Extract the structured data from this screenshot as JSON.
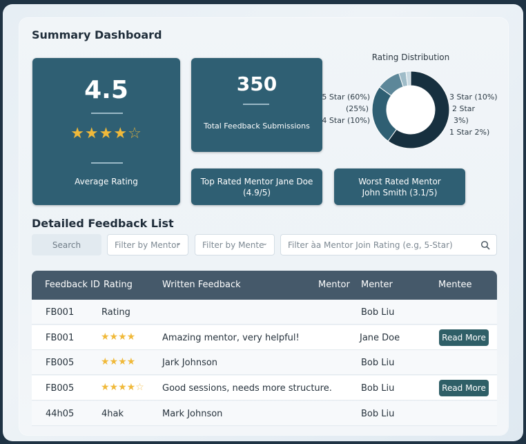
{
  "summary": {
    "title": "Summary Dashboard",
    "average": {
      "value": "4.5",
      "label": "Average Rating",
      "stars": 4.5
    },
    "total": {
      "value": "350",
      "label": "Total Feedback Submissions"
    },
    "top_mentor": {
      "line1": "Top Rated Mentor Jane Doe",
      "line2": "(4.9/5)"
    },
    "worst_mentor": {
      "line1": "Worst Rated Mentor",
      "line2": "John Smith (3.1/5)"
    },
    "distribution": {
      "title": "Rating Distribution",
      "left_labels": [
        "5 Star (60%)",
        "(25%)",
        "4 Star (10%)"
      ],
      "right_labels": [
        "3 Star (10%)",
        "2 Star",
        "3%)",
        "1 Star 2%)"
      ],
      "segments": [
        {
          "name": "5 Star",
          "percent": 60,
          "color": "#17303f"
        },
        {
          "name": "4 Star",
          "percent": 25,
          "color": "#2f5f73"
        },
        {
          "name": "3 Star",
          "percent": 10,
          "color": "#5d8799"
        },
        {
          "name": "2 Star",
          "percent": 3,
          "color": "#9fbcc8"
        },
        {
          "name": "1 Star",
          "percent": 2,
          "color": "#c9dae2"
        }
      ]
    }
  },
  "feedback": {
    "title": "Detailed Feedback List",
    "search_label": "Search",
    "filter_mentor": "Filter by Mentor",
    "filter_mentee": "Filter by Mente",
    "filter_text": "Filter àa Mentor Join Rating (e.g, 5-Star)",
    "columns": [
      "Feedback ID",
      "Rating",
      "Written Feedback",
      "Mentor",
      "Menter",
      "Mentee"
    ],
    "read_more_label": "Read More",
    "rows": [
      {
        "id": "FB001",
        "rating_text": "Rating",
        "stars": null,
        "feedback": "",
        "mentor": "Bob Liu",
        "read_more": false
      },
      {
        "id": "FB001",
        "rating_text": "",
        "stars": 4,
        "feedback": "Amazing mentor, very helpful!",
        "mentor": "Jane Doe",
        "read_more": true
      },
      {
        "id": "FB005",
        "rating_text": "",
        "stars": 4,
        "feedback": "Jark Johnson",
        "mentor": "Bob Liu",
        "read_more": false
      },
      {
        "id": "FB005",
        "rating_text": "",
        "stars": 4.5,
        "feedback": "Good sessions, needs more structure.",
        "mentor": "Bob Liu",
        "read_more": true
      },
      {
        "id": "44h05",
        "rating_text": "4hak",
        "stars": null,
        "feedback": "Mark Johnson",
        "mentor": "Bob Liu",
        "read_more": false
      }
    ]
  },
  "colors": {
    "card": "#2f5f73",
    "header": "#45596a",
    "star": "#f0b93a",
    "button": "#2f5f67"
  }
}
